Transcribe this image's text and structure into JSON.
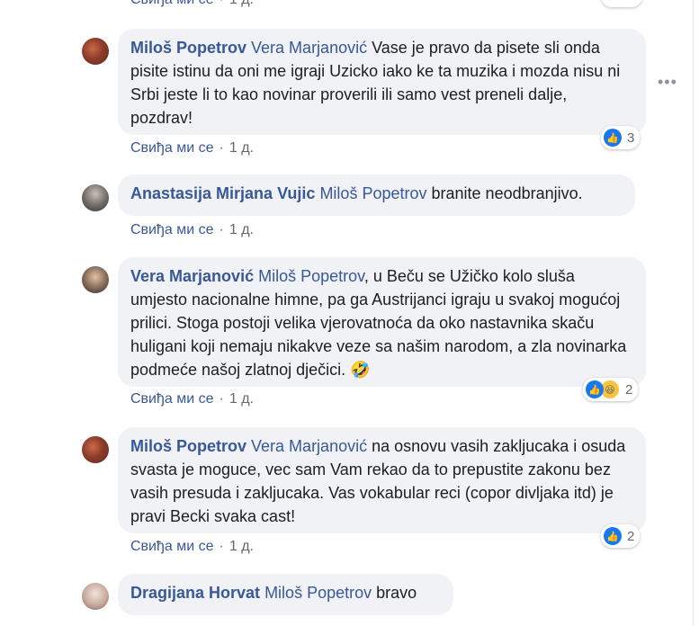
{
  "actions": {
    "like": "Свиђа ми се",
    "separator": "·",
    "time": "1 д."
  },
  "top_partial": {
    "like": "Свиђа ми се",
    "time": "1 д."
  },
  "comments": [
    {
      "author": "Miloš Popetrov",
      "mention": "Vera Marjanović",
      "text": "Vase je pravo da pisete sli onda pisite istinu da oni me igraji Uzicko iako ke ta muzika i mozda nisu ni Srbi jeste li to kao novinar proverili ili samo vest preneli dalje, pozdrav!",
      "reaction_count": "3"
    },
    {
      "author": "Anastasija Mirjana Vujic",
      "mention": "Miloš Popetrov",
      "text": "branite neodbranjivo."
    },
    {
      "author": "Vera Marjanović",
      "mention": "Miloš Popetrov",
      "text": ", u Beču se Užičko kolo sluša umjesto nacionalne himne, pa ga Austrijanci igraju u svakoj mogućoj prilici. Stoga postoji velika vjerovatnoća da oko nastavnika skaču huligani koji nemaju nikakve veze sa našim narodom, a zla novinarka podmeće našoj zlatnoj dječici.",
      "emoji": "🤣",
      "reaction_count": "2"
    },
    {
      "author": "Miloš Popetrov",
      "mention": "Vera Marjanović",
      "text": "na osnovu vasih zakljucaka i osuda svasta je moguce, vec sam Vam rekao da to prepustite zakonu bez vasih presuda i zakljucaka. Vas vokabular reci (copor divljaka itd) je pravi Becki svaka cast!",
      "reaction_count": "2"
    },
    {
      "author": "Dragijana Horvat",
      "mention": "Miloš Popetrov",
      "text": "bravo"
    }
  ],
  "icons": {
    "like": "like-icon",
    "haha": "haha-icon",
    "more": "more-options-icon"
  }
}
